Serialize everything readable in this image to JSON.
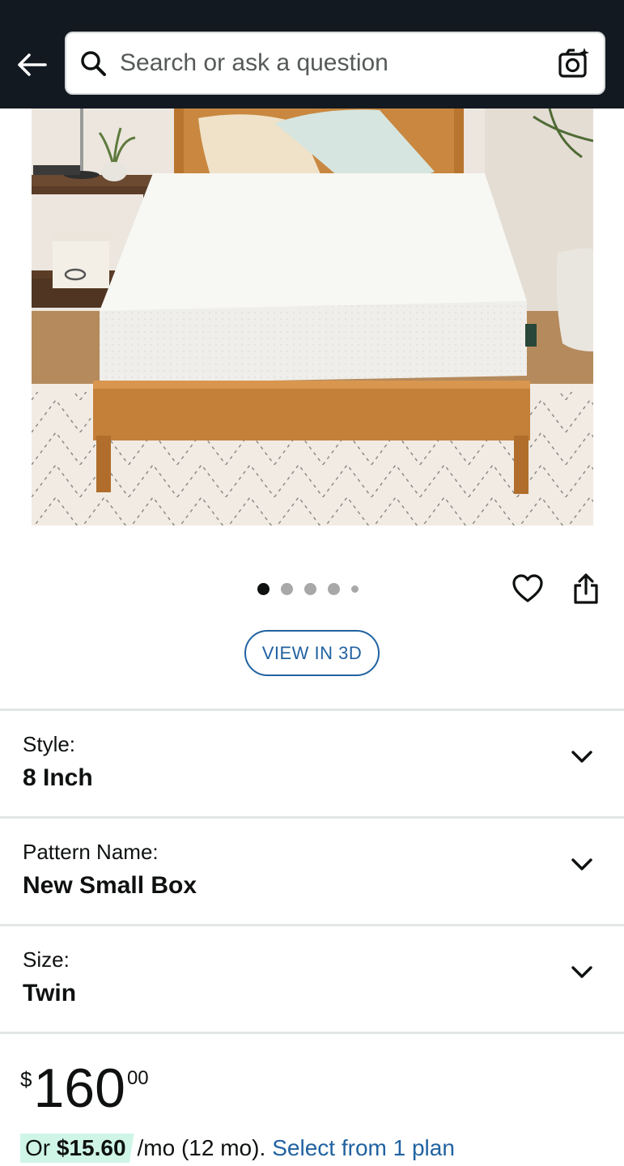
{
  "search": {
    "placeholder": "Search or ask a question"
  },
  "carousel": {
    "total_images": 5,
    "active_index": 0
  },
  "actions": {
    "view_3d_label": "VIEW IN 3D"
  },
  "variations": [
    {
      "label": "Style:",
      "value": "8 Inch"
    },
    {
      "label": "Pattern Name:",
      "value": "New Small Box"
    },
    {
      "label": "Size:",
      "value": "Twin"
    }
  ],
  "price": {
    "symbol": "$",
    "whole": "160",
    "fraction": "00"
  },
  "monthly": {
    "prefix": "Or",
    "amount": "$15.60",
    "terms": "/mo (12 mo).",
    "link": "Select from 1 plan"
  },
  "colors": {
    "header_bg": "#131921",
    "link": "#2162a1",
    "highlight": "#cff5e7"
  }
}
